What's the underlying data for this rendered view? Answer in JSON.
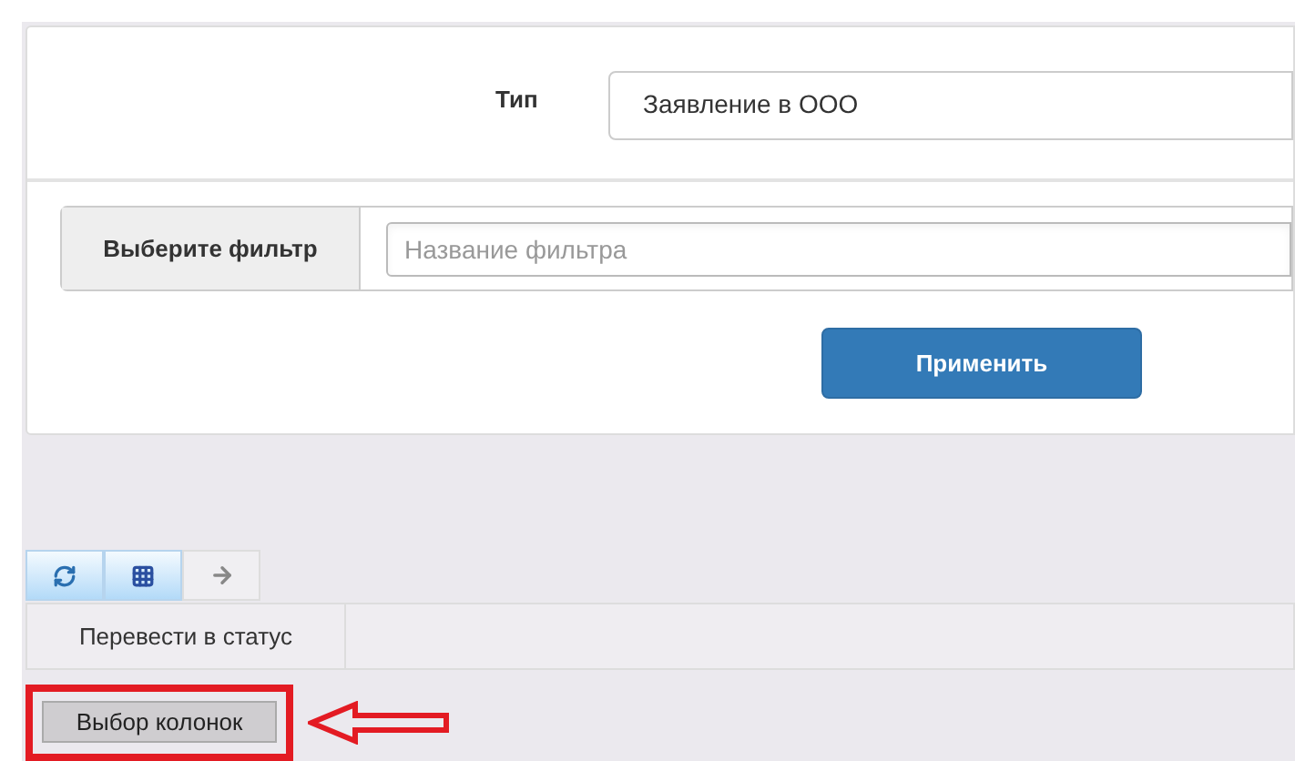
{
  "type_field": {
    "label": "Тип",
    "value": "Заявление в ООО"
  },
  "filter": {
    "label": "Выберите фильтр",
    "placeholder": "Название фильтра"
  },
  "apply_button": "Применить",
  "toolbar": [
    {
      "kind": "refresh",
      "active": true
    },
    {
      "kind": "columns",
      "active": true
    },
    {
      "kind": "arrow",
      "active": false
    }
  ],
  "status_button": "Перевести в статус",
  "columns_button": {
    "label": "Выбор колонок",
    "highlighted": true
  }
}
